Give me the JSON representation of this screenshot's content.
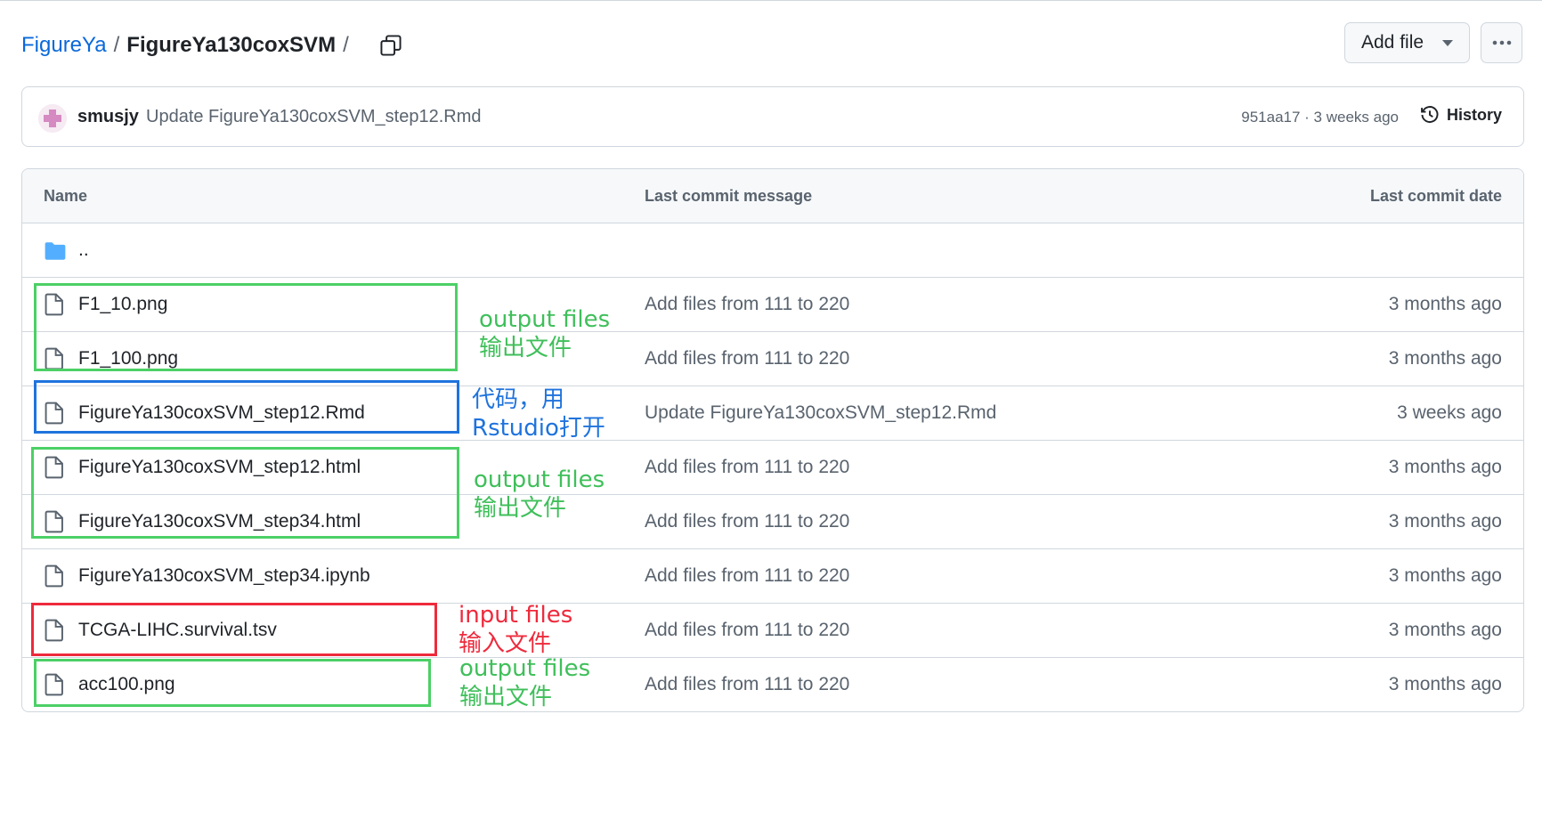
{
  "breadcrumb": {
    "owner": "FigureYa",
    "separator": "/",
    "repo_path": "FigureYa130coxSVM",
    "trailing_separator": "/"
  },
  "toolbar": {
    "add_file_label": "Add file"
  },
  "latest_commit": {
    "author": "smusjy",
    "message": "Update FigureYa130coxSVM_step12.Rmd",
    "meta": "951aa17 · 3 weeks ago",
    "history_label": "History"
  },
  "table": {
    "headers": {
      "name": "Name",
      "message": "Last commit message",
      "date": "Last commit date"
    },
    "parent_dir": "..",
    "rows": [
      {
        "name": "F1_10.png",
        "message": "Add files from 111 to 220",
        "date": "3 months ago"
      },
      {
        "name": "F1_100.png",
        "message": "Add files from 111 to 220",
        "date": "3 months ago"
      },
      {
        "name": "FigureYa130coxSVM_step12.Rmd",
        "message": "Update FigureYa130coxSVM_step12.Rmd",
        "date": "3 weeks ago"
      },
      {
        "name": "FigureYa130coxSVM_step12.html",
        "message": "Add files from 111 to 220",
        "date": "3 months ago"
      },
      {
        "name": "FigureYa130coxSVM_step34.html",
        "message": "Add files from 111 to 220",
        "date": "3 months ago"
      },
      {
        "name": "FigureYa130coxSVM_step34.ipynb",
        "message": "Add files from 111 to 220",
        "date": "3 months ago"
      },
      {
        "name": "TCGA-LIHC.survival.tsv",
        "message": "Add files from 111 to 220",
        "date": "3 months ago"
      },
      {
        "name": "acc100.png",
        "message": "Add files from 111 to 220",
        "date": "3 months ago"
      }
    ]
  },
  "annotations": [
    {
      "line1": "output files",
      "line2": "输出文件",
      "color": "#3fbf5a"
    },
    {
      "line1": "代码，用",
      "line2": "Rstudio打开",
      "color": "#1f73dd"
    },
    {
      "line1": "output files",
      "line2": "输出文件",
      "color": "#3fbf5a"
    },
    {
      "line1": "input files",
      "line2": "输入文件",
      "color": "#ee2a3c"
    },
    {
      "line1": "output files",
      "line2": "输出文件",
      "color": "#3fbf5a"
    }
  ],
  "icons": {
    "copy": "copy-icon",
    "caret": "triangle-down-icon",
    "more": "kebab-horizontal-icon",
    "history": "history-icon",
    "folder": "folder-icon",
    "file": "file-icon"
  }
}
